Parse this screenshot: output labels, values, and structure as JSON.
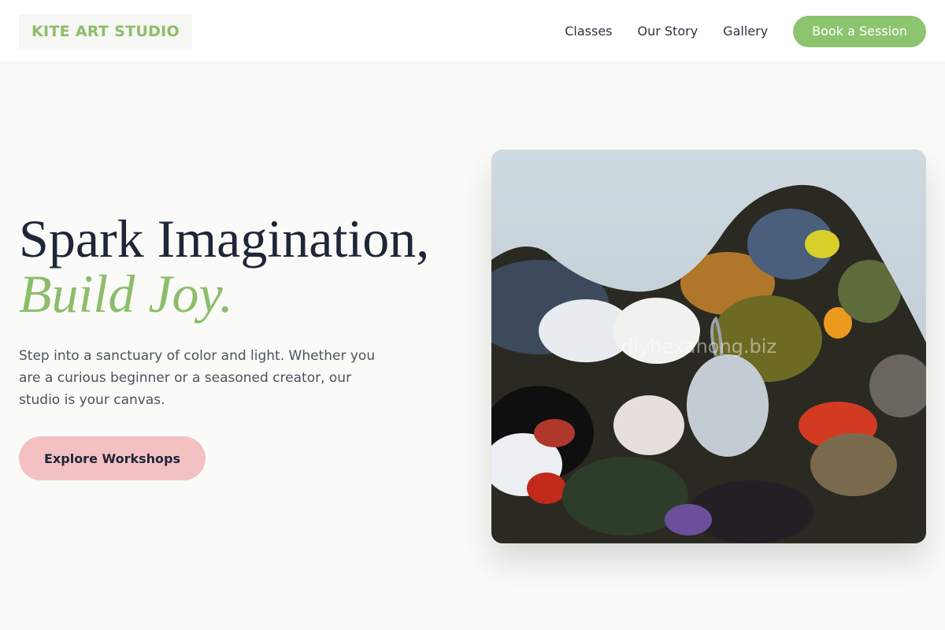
{
  "header": {
    "logo": "KITE ART STUDIO",
    "nav": [
      "Classes",
      "Our Story",
      "Gallery"
    ],
    "cta": "Book a Session"
  },
  "hero": {
    "title_line1": "Spark Imagination,",
    "title_line2": "Build Joy.",
    "description": "Step into a sanctuary of color and light. Whether you are a curious beginner or a seasoned creator, our studio is your canvas.",
    "button": "Explore Workshops",
    "image": {
      "subject": "paint-palette-photo",
      "watermark": "diyhexahong.biz"
    }
  },
  "colors": {
    "accent_green": "#8cc46f",
    "logo_green": "#8cbd6b",
    "button_pink": "#f3c1c2",
    "text_dark": "#1e2637"
  }
}
